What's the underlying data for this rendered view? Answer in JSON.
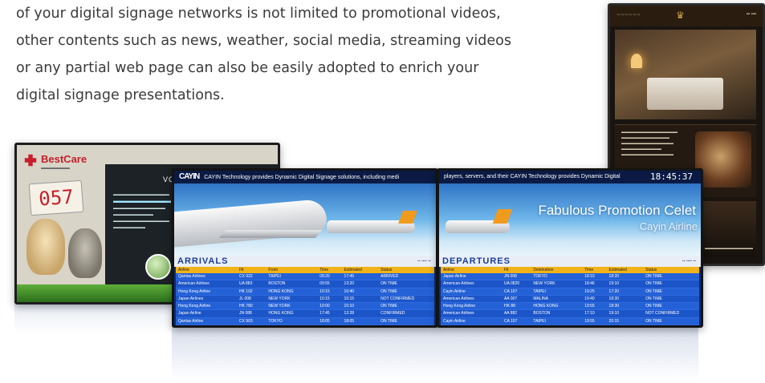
{
  "intro": {
    "lines": [
      "of your digital signage networks is not limited to promotional videos,",
      "other contents such as news, weather, social media, streaming videos",
      "or any partial web page can also be easily adopted to enrich your",
      "digital signage presentations."
    ]
  },
  "hotel": {
    "logo": "♛"
  },
  "vet": {
    "brand": "BestCare",
    "counter": "057",
    "panel_heading": "VOLUNTE"
  },
  "arrivals": {
    "ticker_brand": "CAYIN",
    "ticker_text": "CAYIN Technology provides Dynamic Digital Signage solutions, including medi",
    "board_title": "ARRIVALS",
    "headers": [
      "Airline",
      "Flt",
      "From",
      "Time",
      "Estimated",
      "Status"
    ],
    "rows": [
      [
        "Qantas Airlines",
        "CX 922",
        "TAIPEI",
        "09:20",
        "17:45",
        "ARRIVED"
      ],
      [
        "American Airlines",
        "UA 883",
        "BOSTON",
        "09:55",
        "13:20",
        "ON TIME"
      ],
      [
        "Hong Kong Airline",
        "HK 102",
        "HONG KONG",
        "10:15",
        "10:40",
        "ON TIME"
      ],
      [
        "Japan Airlines",
        "JL 008",
        "NEW YORK",
        "10:15",
        "10:15",
        "NOT CONFIRMED"
      ],
      [
        "Hong Kong Airline",
        "HK 780",
        "NEW YORK",
        "10:00",
        "10:10",
        "ON TIME"
      ],
      [
        "Japan Airline",
        "JN 088",
        "HONG KONG",
        "17:45",
        "12:28",
        "CONFIRMED"
      ],
      [
        "Qantas Airline",
        "CX 903",
        "TOKYO",
        "18:05",
        "18:05",
        "ON TIME"
      ]
    ]
  },
  "departures": {
    "ticker_text": "players, servers, and their CAYIN Technology provides Dynamic Digital",
    "clock": "18:45:37",
    "promo": "Fabulous Promotion Celet",
    "promo2": "Cayin Airline",
    "board_title": "DEPARTURES",
    "headers": [
      "Airline",
      "Flt",
      "Destination",
      "Time",
      "Estimated",
      "Status"
    ],
    "rows": [
      [
        "Japan Airline",
        "JN 008",
        "TOKYO",
        "18:10",
        "18:20",
        "ON TIME"
      ],
      [
        "American Airlines",
        "UA 0820",
        "NEW YORK",
        "18:46",
        "19:10",
        "ON TIME"
      ],
      [
        "Cayin Airline",
        "CA 107",
        "TAIPEI",
        "19:25",
        "17:20",
        "ON TIME"
      ],
      [
        "American Airlines",
        "AA 007",
        "MALINA",
        "19:40",
        "18:30",
        "ON TIME"
      ],
      [
        "Hong Kong Airline",
        "HK 88",
        "HONG KONG",
        "19:55",
        "18:30",
        "ON TIME"
      ],
      [
        "American Airlines",
        "AA 882",
        "BOSTON",
        "17:10",
        "19:10",
        "NOT CONFIRMED"
      ],
      [
        "Cayin Airline",
        "CA 107",
        "TAIPEI",
        "19:55",
        "20:15",
        "ON TIME"
      ]
    ]
  }
}
